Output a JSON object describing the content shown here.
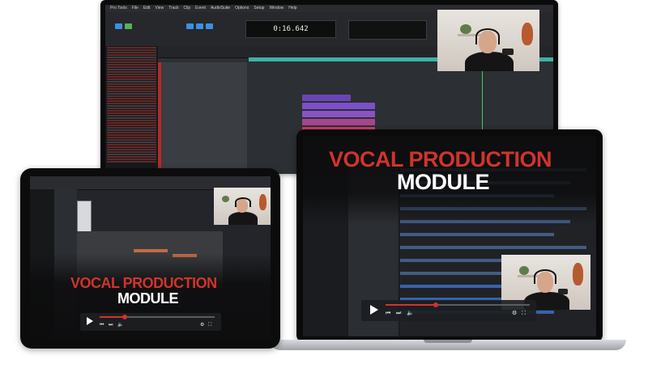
{
  "monitor": {
    "menu": [
      "Pro Tools",
      "File",
      "Edit",
      "View",
      "Track",
      "Clip",
      "Event",
      "AudioSuite",
      "Options",
      "Setup",
      "Window",
      "Help"
    ],
    "counter": "0:16.642"
  },
  "laptop": {
    "title_line1": "VOCAL PRODUCTION",
    "title_line2": "MODULE"
  },
  "tablet": {
    "title_line1": "VOCAL PRODUCTION",
    "title_line2": "MODULE"
  },
  "player": {
    "play_icon": "play-icon",
    "prev_icon": "skip-back-icon",
    "next_icon": "skip-forward-icon",
    "volume_icon": "volume-icon",
    "settings_icon": "gear-icon",
    "fullscreen_icon": "fullscreen-icon",
    "progress_laptop": 0.35,
    "progress_tablet": 0.22
  },
  "colors": {
    "accent_red": "#d0342c",
    "daw_blue": "#3c8fe3",
    "clip_purple": "#7b4fc9",
    "clip_teal": "#3fb0a8"
  }
}
